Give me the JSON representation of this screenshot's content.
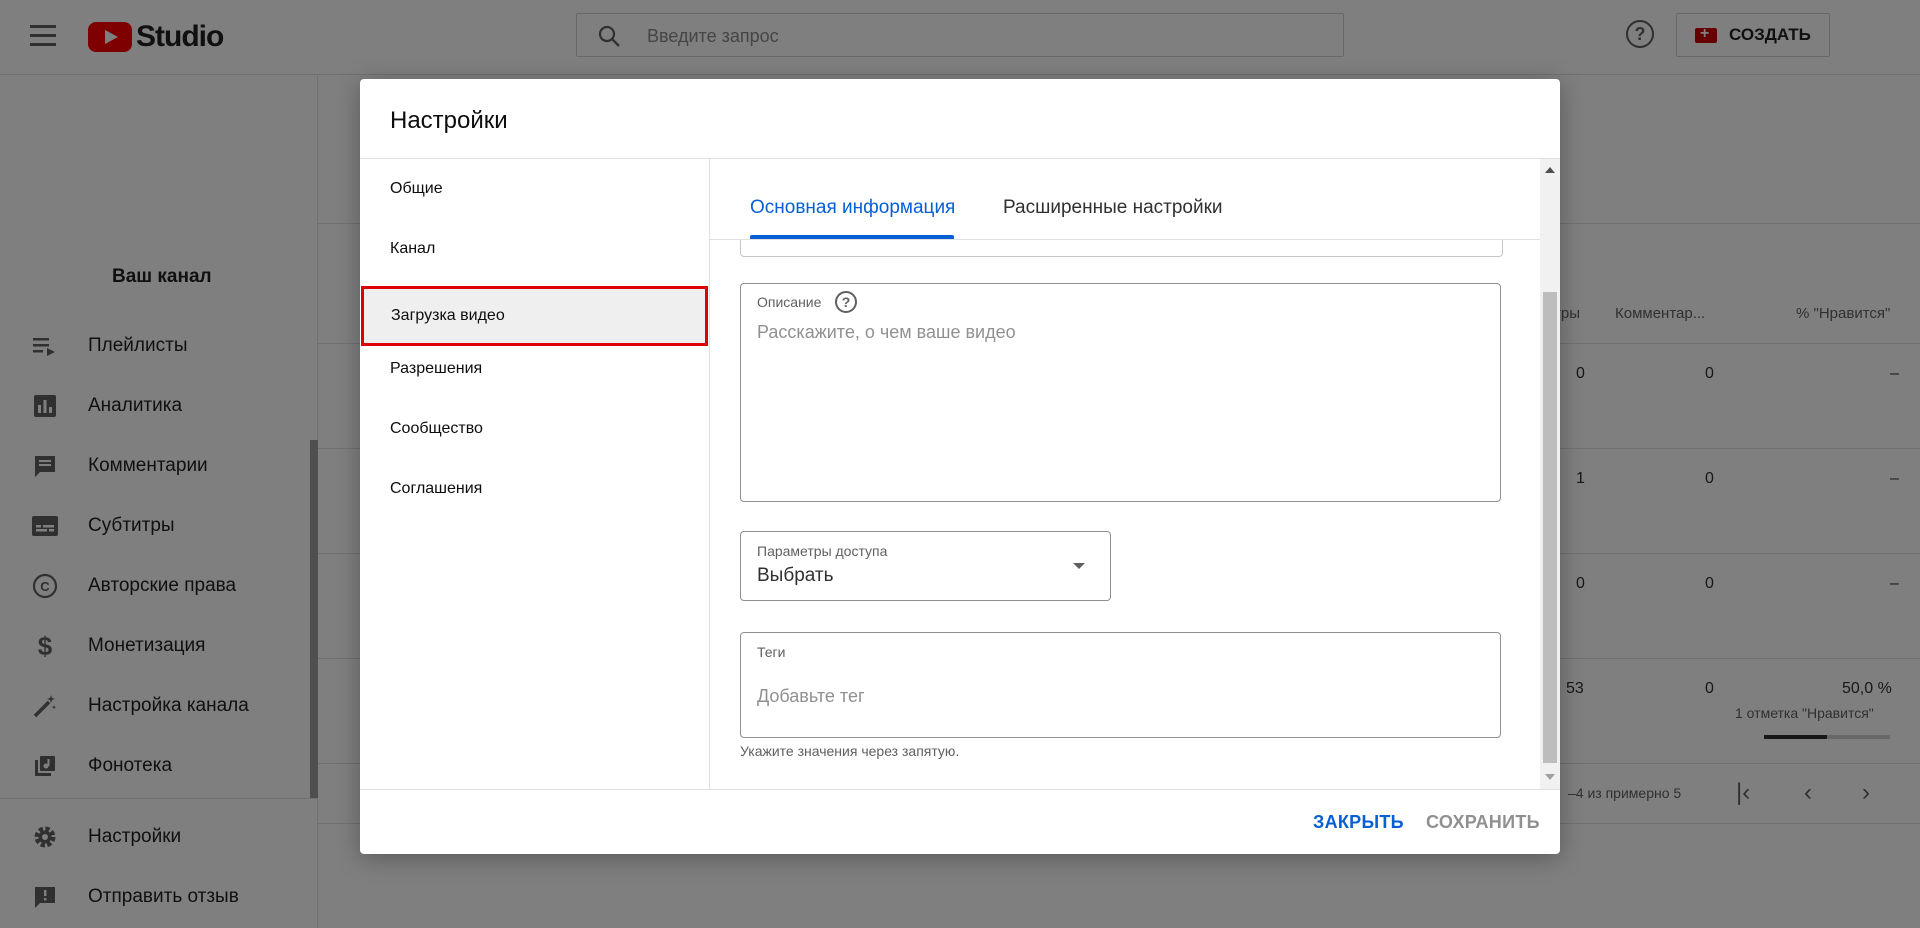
{
  "header": {
    "logo_text": "Studio",
    "search_placeholder": "Введите запрос",
    "create_label": "СОЗДАТЬ",
    "brand_color": "#ff0000"
  },
  "sidebar": {
    "channel_label": "Ваш канал",
    "items": [
      {
        "label": "Плейлисты",
        "icon": "playlist-icon"
      },
      {
        "label": "Аналитика",
        "icon": "analytics-icon"
      },
      {
        "label": "Комментарии",
        "icon": "comments-icon"
      },
      {
        "label": "Субтитры",
        "icon": "subtitles-icon"
      },
      {
        "label": "Авторские права",
        "icon": "copyright-icon"
      },
      {
        "label": "Монетизация",
        "icon": "dollar-icon"
      },
      {
        "label": "Настройка канала",
        "icon": "magic-wand-icon"
      },
      {
        "label": "Фонотека",
        "icon": "audio-library-icon"
      }
    ],
    "bottom_items": [
      {
        "label": "Настройки",
        "icon": "gear-icon"
      },
      {
        "label": "Отправить отзыв",
        "icon": "feedback-icon"
      }
    ]
  },
  "table": {
    "headers": [
      "тры",
      "Комментар...",
      "% \"Нравится\""
    ],
    "rows": [
      {
        "views": "0",
        "comments": "0",
        "likes": "–"
      },
      {
        "views": "1",
        "comments": "0",
        "likes": "–"
      },
      {
        "views": "0",
        "comments": "0",
        "likes": "–"
      },
      {
        "views": "53",
        "comments": "0",
        "likes": "50,0 %",
        "likes_sub": "1 отметка \"Нравится\"",
        "likes_fraction": 0.5
      }
    ],
    "pagination": "–4 из примерно 5"
  },
  "dialog": {
    "title": "Настройки",
    "nav": [
      "Общие",
      "Канал",
      "Загрузка видео",
      "Разрешения",
      "Сообщество",
      "Соглашения"
    ],
    "active_nav_index": 2,
    "tabs": [
      "Основная информация",
      "Расширенные настройки"
    ],
    "active_tab_index": 0,
    "description": {
      "label": "Описание",
      "placeholder": "Расскажите, о чем ваше видео"
    },
    "visibility": {
      "label": "Параметры доступа",
      "value": "Выбрать"
    },
    "tags": {
      "label": "Теги",
      "placeholder": "Добавьте тег",
      "hint": "Укажите значения через запятую."
    },
    "buttons": {
      "close": "ЗАКРЫТЬ",
      "save": "СОХРАНИТЬ"
    },
    "accent_color": "#065fd4",
    "highlight_color": "#e00000"
  }
}
